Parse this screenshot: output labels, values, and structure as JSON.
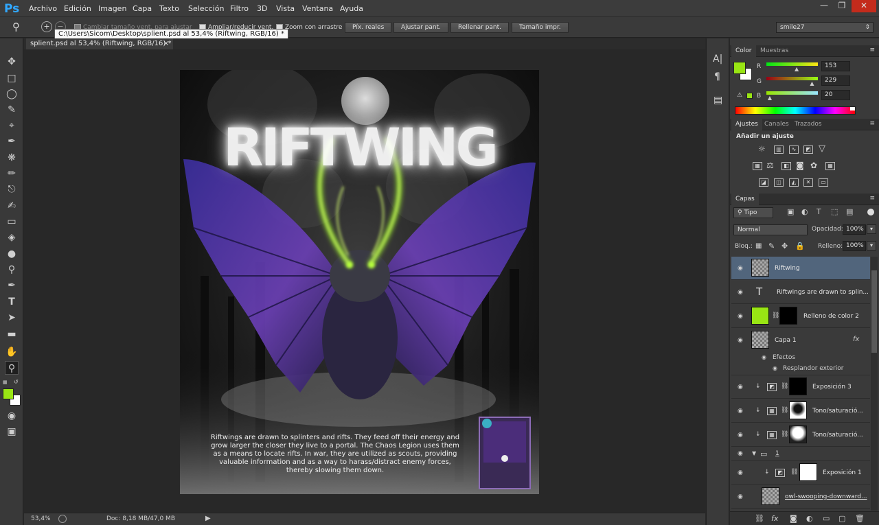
{
  "app": {
    "logo": "Ps",
    "menu": [
      "Archivo",
      "Edición",
      "Imagen",
      "Capa",
      "Texto",
      "Selección",
      "Filtro",
      "3D",
      "Vista",
      "Ventana",
      "Ayuda"
    ],
    "window_controls": [
      "—",
      "❐",
      "✕"
    ]
  },
  "options_bar": {
    "resize_windows_label": "Cambiar tamaño vent. para ajustar",
    "zoom_all_label": "Ampliar/reducir vent.",
    "scrubby_zoom_label": "Zoom con arrastre",
    "buttons": [
      "Píx. reales",
      "Ajustar pant.",
      "Rellenar pant.",
      "Tamaño impr."
    ],
    "workspace": "smile27",
    "tooltip": "C:\\Users\\Sicom\\Desktop\\splient.psd al 53,4% (Riftwing, RGB/16) *"
  },
  "document": {
    "tab_title": "splient.psd al 53,4% (Riftwing, RGB/16) *",
    "artwork_title": "RIFTWING",
    "artwork_description": "Riftwings are drawn to splinters and rifts. They feed off their energy and grow larger the closer they live to a portal. The Chaos Legion uses them as a means to locate rifts. In war, they are utilized as scouts, providing valuable information and as a way to harass/distract enemy forces, thereby slowing them down."
  },
  "status": {
    "zoom": "53,4%",
    "doc_size": "Doc: 8,18 MB/47,0 MB"
  },
  "color_panel": {
    "tabs": [
      "Color",
      "Muestras"
    ],
    "r_label": "R",
    "g_label": "G",
    "b_label": "B",
    "r": 153,
    "g": 229,
    "b": 20,
    "r_value": "153",
    "g_value": "229",
    "b_value": "20",
    "foreground": "#99e514",
    "background": "#ffffff"
  },
  "adjustments_panel": {
    "tabs": [
      "Ajustes",
      "Canales",
      "Trazados"
    ],
    "title": "Añadir un ajuste"
  },
  "layers_panel": {
    "tab": "Capas",
    "filter_kind": "Tipo",
    "blend_mode": "Normal",
    "opacity_label": "Opacidad:",
    "opacity": "100%",
    "lock_label": "Bloq.:",
    "fill_label": "Relleno:",
    "fill": "100%",
    "layers": [
      {
        "name": "Riftwing"
      },
      {
        "name": "Riftwings are drawn to splin..."
      },
      {
        "name": "Relleno de color 2"
      },
      {
        "name": "Capa 1",
        "fx": "fx"
      },
      {
        "name": "Efectos"
      },
      {
        "name": "Resplandor exterior"
      },
      {
        "name": "Exposición 3"
      },
      {
        "name": "Tono/saturació..."
      },
      {
        "name": "Tono/saturació..."
      },
      {
        "name": "1"
      },
      {
        "name": "Exposición 1"
      },
      {
        "name": "owl-swooping-downward..."
      }
    ]
  }
}
